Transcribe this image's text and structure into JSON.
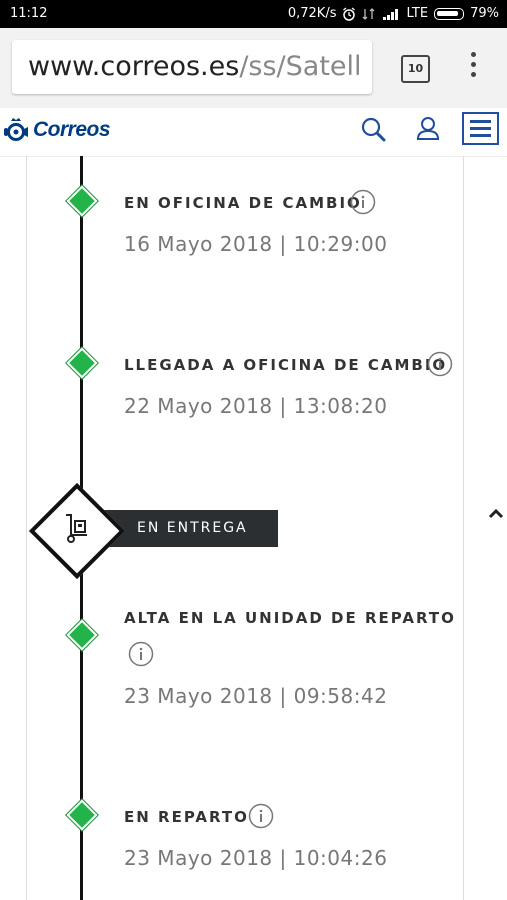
{
  "status_bar": {
    "time": "11:12",
    "speed": "0,72K/s",
    "network": "LTE",
    "battery": "79%"
  },
  "browser": {
    "url_host": "www.correos.es",
    "url_path": "/ss/Satell",
    "tab_count": "10"
  },
  "site": {
    "brand": "Correos"
  },
  "timeline": {
    "events": [
      {
        "status": "EN OFICINA DE CAMBIO",
        "date": "16 Mayo 2018 | 10:29:00"
      },
      {
        "status": "LLEGADA A OFICINA DE CAMBIO",
        "date": "22 Mayo 2018 | 13:08:20"
      },
      {
        "status": "ALTA EN LA UNIDAD DE REPARTO",
        "date": "23 Mayo 2018 | 09:58:42"
      },
      {
        "status": "EN REPARTO",
        "date": "23 Mayo 2018 | 10:04:26"
      }
    ],
    "stage": {
      "label": "EN ENTREGA",
      "icon": "hand-truck-icon"
    }
  },
  "colors": {
    "node_green": "#22b34a",
    "brand_blue": "#003c7f",
    "banner_bg": "#2c2f31"
  }
}
